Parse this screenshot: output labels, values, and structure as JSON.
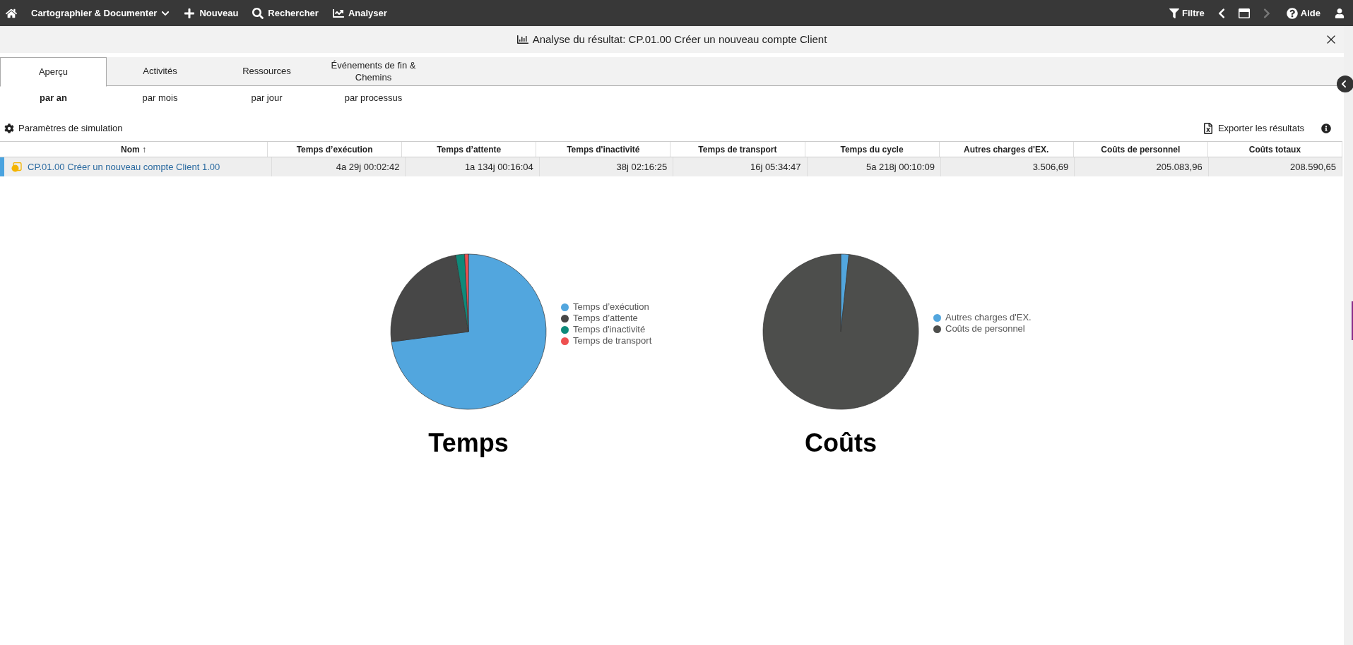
{
  "top_bar": {
    "menu": [
      {
        "label": "Cartographier & Documenter",
        "kind": "dropdown"
      },
      {
        "label": "Nouveau",
        "kind": "new"
      },
      {
        "label": "Rechercher",
        "kind": "search"
      },
      {
        "label": "Analyser",
        "kind": "analyze"
      }
    ],
    "filter": "Filtre",
    "forward_disabled": true,
    "help": "Aide"
  },
  "dialog": {
    "title": "Analyse du résultat: CP.01.00 Créer un nouveau compte Client"
  },
  "tabs": [
    {
      "label": "Aperçu",
      "selected": true
    },
    {
      "label": "Activités",
      "selected": false
    },
    {
      "label": "Ressources",
      "selected": false
    },
    {
      "label": "Événements de fin & Chemins",
      "selected": false
    }
  ],
  "subtabs": [
    {
      "label": "par an",
      "selected": true
    },
    {
      "label": "par mois",
      "selected": false
    },
    {
      "label": "par jour",
      "selected": false
    },
    {
      "label": "par processus",
      "selected": false
    }
  ],
  "simulation_params": "Paramètres de simulation",
  "export": "Exporter les résultats",
  "table": {
    "columns": [
      "Nom ↑",
      "Temps d’exécution",
      "Temps d’attente",
      "Temps d'inactivité",
      "Temps de transport",
      "Temps du cycle",
      "Autres charges d'EX.",
      "Coûts de personnel",
      "Coûts totaux"
    ],
    "rows": [
      {
        "selected": true,
        "cells": [
          "CP.01.00 Créer un nouveau compte Client 1.00",
          "4a 29j 00:02:42",
          "1a 134j 00:16:04",
          "38j 02:16:25",
          "16j 05:34:47",
          "5a 218j 00:10:09",
          "3.506,69",
          "205.083,96",
          "208.590,65"
        ]
      }
    ]
  },
  "charts": [
    {
      "chart_data": {
        "type": "pie",
        "title": "Temps",
        "categories": [
          "Temps d’exécution",
          "Temps d’attente",
          "Temps d'inactivité",
          "Temps de transport"
        ],
        "values": [
          72.92,
          24.44,
          1.86,
          0.78
        ],
        "legend": "right",
        "colors": [
          "#52a6de",
          "#474747",
          "#0e8a7a",
          "#ee5050"
        ]
      }
    },
    {
      "chart_data": {
        "type": "pie",
        "title": "Coûts",
        "categories": [
          "Autres charges d'EX.",
          "Coûts de personnel"
        ],
        "values": [
          1.68,
          98.32
        ],
        "legend": "right",
        "colors": [
          "#52a6de",
          "#4d4e4c"
        ]
      }
    }
  ]
}
